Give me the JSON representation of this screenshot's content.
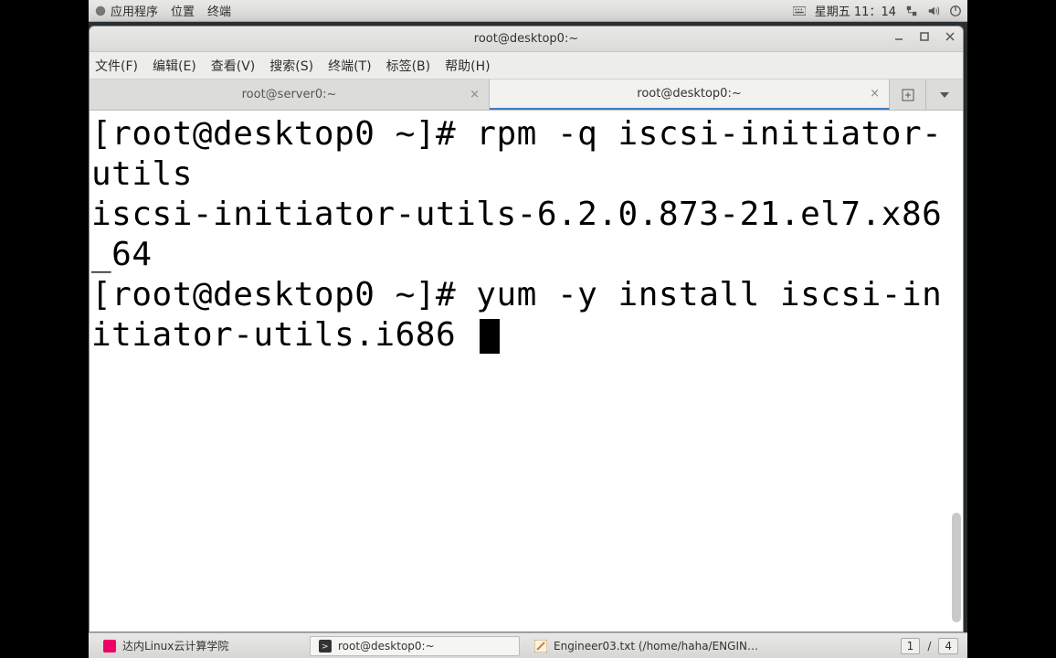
{
  "topbar": {
    "apps_label": "应用程序",
    "places_label": "位置",
    "terminal_label": "终端",
    "clock": "星期五 11：14"
  },
  "window": {
    "title": "root@desktop0:~"
  },
  "menubar": {
    "file": "文件(F)",
    "edit": "编辑(E)",
    "view": "查看(V)",
    "search": "搜索(S)",
    "terminal": "终端(T)",
    "tabs": "标签(B)",
    "help": "帮助(H)"
  },
  "tabs": [
    {
      "label": "root@server0:~",
      "active": false
    },
    {
      "label": "root@desktop0:~",
      "active": true
    }
  ],
  "terminal": {
    "line1": "[root@desktop0 ~]# rpm -q iscsi-initiator-utils",
    "line2": "iscsi-initiator-utils-6.2.0.873-21.el7.x86_64",
    "line3": "[root@desktop0 ~]# yum -y install iscsi-initiator-utils.i686 "
  },
  "taskbar": {
    "items": [
      {
        "label": "达内Linux云计算学院"
      },
      {
        "label": "root@desktop0:~"
      },
      {
        "label": "Engineer03.txt (/home/haha/ENGIN…"
      }
    ],
    "pager_current": "1",
    "pager_total": "4"
  }
}
